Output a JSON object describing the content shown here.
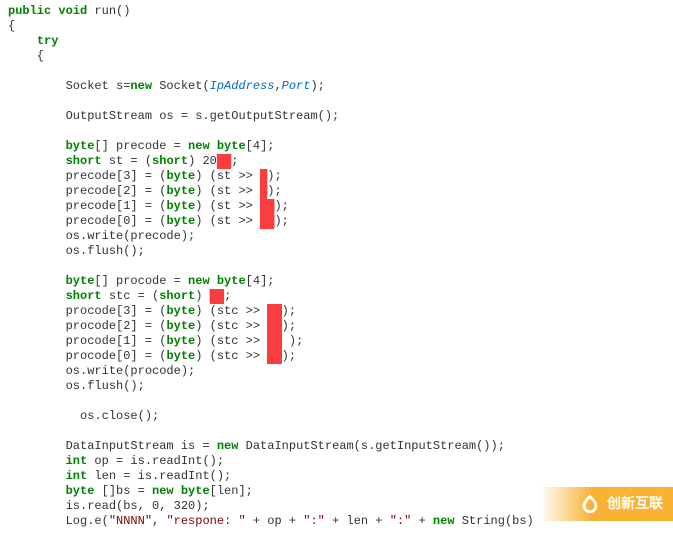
{
  "code": {
    "l1a": "public",
    "l1b": "void",
    "l1c": " run()",
    "l2": "{",
    "l3a": "    ",
    "l3b": "try",
    "l4": "    {",
    "l5": "",
    "l6a": "        Socket s=",
    "l6b": "new",
    "l6c": " Socket(",
    "l6d": "IpAddress",
    "l6e": ",",
    "l6f": "Port",
    "l6g": ");",
    "l7": "",
    "l8": "        OutputStream os = s.getOutputStream();",
    "l9": "",
    "l10a": "        ",
    "l10b": "byte",
    "l10c": "[] precode = ",
    "l10d": "new",
    "l10e": " ",
    "l10f": "byte",
    "l10g": "[4];",
    "l11a": "        ",
    "l11b": "short",
    "l11c": " st = (",
    "l11d": "short",
    "l11e": ") 20",
    "l11f": "██",
    "l11g": ";",
    "l12a": "        precode[3] = (",
    "l12b": "byte",
    "l12c": ") (st >> ",
    "l12d": "█",
    "l12e": ");",
    "l13a": "        precode[2] = (",
    "l13b": "byte",
    "l13c": ") (st >> ",
    "l13d": "█",
    "l13e": ");",
    "l14a": "        precode[1] = (",
    "l14b": "byte",
    "l14c": ") (st >> ",
    "l14d": "██",
    "l14e": ");",
    "l15a": "        precode[0] = (",
    "l15b": "byte",
    "l15c": ") (st >> ",
    "l15d": "██",
    "l15e": ");",
    "l16": "        os.write(precode);",
    "l17": "        os.flush();",
    "l18": "",
    "l19a": "        ",
    "l19b": "byte",
    "l19c": "[] procode = ",
    "l19d": "new",
    "l19e": " ",
    "l19f": "byte",
    "l19g": "[4];",
    "l20a": "        ",
    "l20b": "short",
    "l20c": " stc = (",
    "l20d": "short",
    "l20e": ") ",
    "l20f": "██",
    "l20g": ";",
    "l21a": "        procode[3] = (",
    "l21b": "byte",
    "l21c": ") (stc >> ",
    "l21d": "██",
    "l21e": ");",
    "l22a": "        procode[2] = (",
    "l22b": "byte",
    "l22c": ") (stc >> ",
    "l22d": "██",
    "l22e": ");",
    "l23a": "        procode[1] = (",
    "l23b": "byte",
    "l23c": ") (stc >> ",
    "l23d": "██",
    "l23e": " );",
    "l24a": "        procode[0] = (",
    "l24b": "byte",
    "l24c": ") (stc >> ",
    "l24d": "██",
    "l24e": ");",
    "l25": "        os.write(procode);",
    "l26": "        os.flush();",
    "l27": "",
    "l28": "          os.close();",
    "l29": "",
    "l30a": "        DataInputStream is = ",
    "l30b": "new",
    "l30c": " DataInputStream(s.getInputStream());",
    "l31a": "        ",
    "l31b": "int",
    "l31c": " op = is.readInt();",
    "l32a": "        ",
    "l32b": "int",
    "l32c": " len = is.readInt();",
    "l33a": "        ",
    "l33b": "byte",
    "l33c": " []bs = ",
    "l33d": "new",
    "l33e": " ",
    "l33f": "byte",
    "l33g": "[len];",
    "l34": "        is.read(bs, 0, 320);",
    "l35a": "        Log.e(",
    "l35b": "\"NNNN\"",
    "l35c": ", ",
    "l35d": "\"respone: \"",
    "l35e": " + op + ",
    "l35f": "\":\"",
    "l35g": " + len + ",
    "l35h": "\":\"",
    "l35i": " + ",
    "l35j": "new",
    "l35k": " String(bs)"
  },
  "watermark": {
    "text": "创新互联"
  }
}
